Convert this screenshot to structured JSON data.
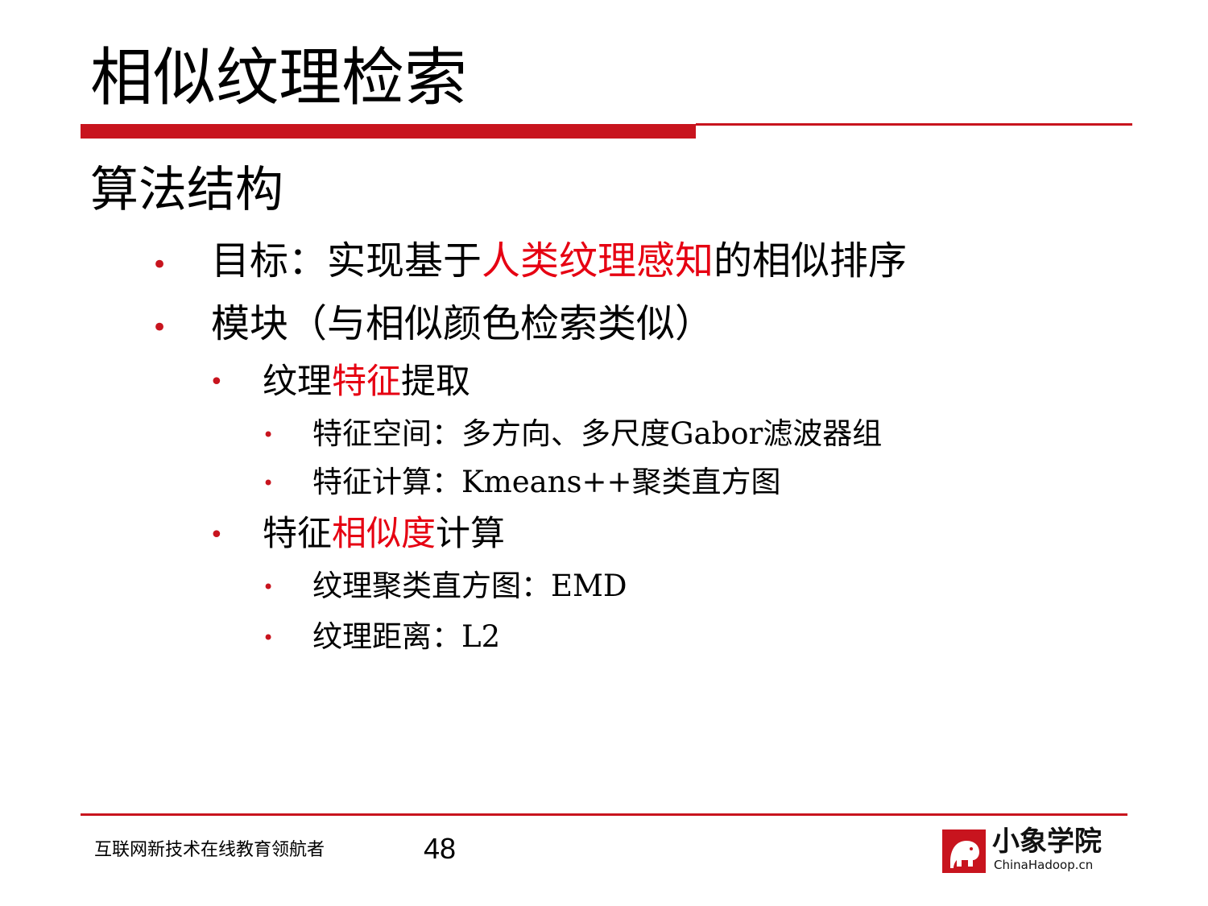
{
  "slide": {
    "title": "相似纹理检索",
    "section_heading": "算法结构"
  },
  "bullets": {
    "goal": {
      "prefix": "目标：实现基于",
      "highlight": "人类纹理感知",
      "suffix": "的相似排序"
    },
    "modules": {
      "text": "模块（与相似颜色检索类似）"
    },
    "feature_extraction": {
      "prefix": "纹理",
      "highlight": "特征",
      "suffix": "提取"
    },
    "feature_space": {
      "text": "特征空间：多方向、多尺度Gabor滤波器组"
    },
    "feature_compute": {
      "text": "特征计算：Kmeans++聚类直方图"
    },
    "similarity": {
      "prefix": "特征",
      "highlight": "相似度",
      "suffix": "计算"
    },
    "histogram_metric": {
      "text": "纹理聚类直方图：EMD"
    },
    "distance_metric": {
      "text": "纹理距离：L2"
    },
    "bullet_char": "•"
  },
  "footer": {
    "slogan": "互联网新技术在线教育领航者",
    "page_number": "48",
    "logo_cn": "小象学院",
    "logo_en": "ChinaHadoop.cn"
  },
  "colors": {
    "accent_red": "#c8141e",
    "highlight_red": "#e60012"
  }
}
